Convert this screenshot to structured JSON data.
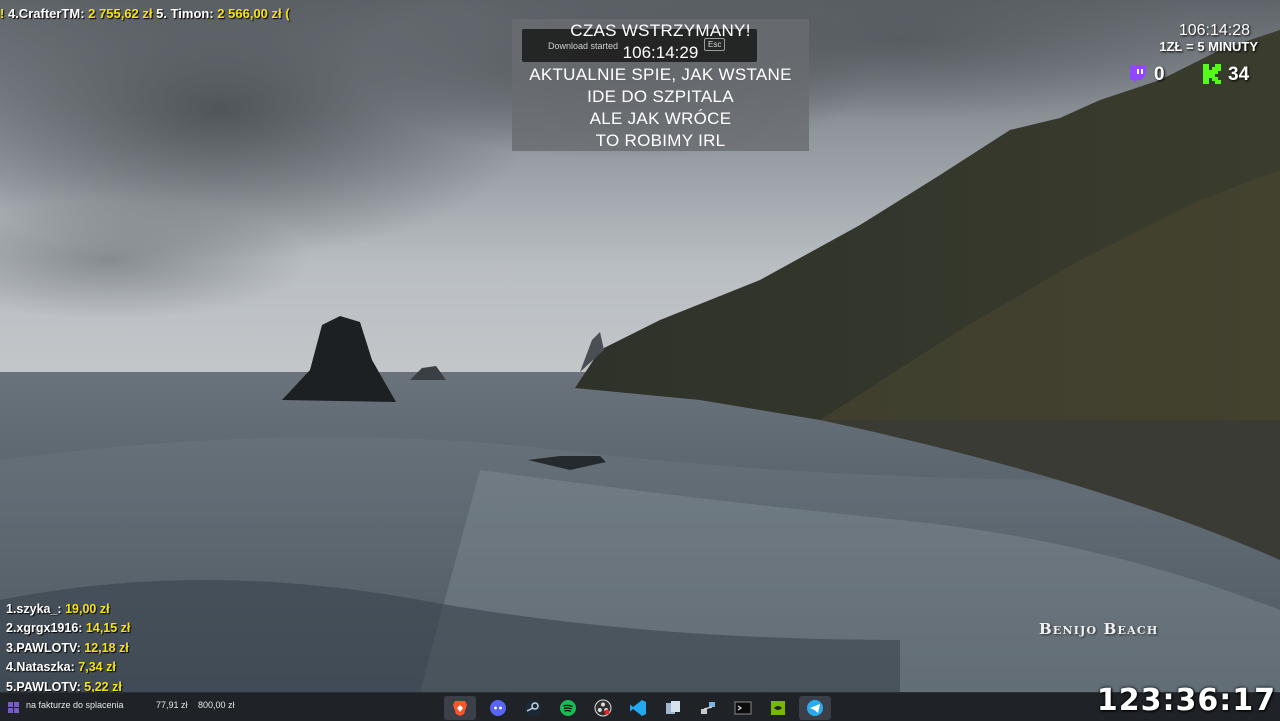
{
  "ticker": {
    "marker": "!",
    "entries": [
      {
        "label": "4.CrafterTM:",
        "amount": "2 755,62 zł"
      },
      {
        "label": "5. Timon:",
        "amount": "2 566,00 zł"
      }
    ],
    "trailing": "("
  },
  "pause": {
    "title": "CZAS WSTRZYMANY!",
    "timer": "106:14:29",
    "lines": [
      "AKTUALNIE SPIE, JAK WSTANE",
      "IDE DO SZPITALA",
      "ALE JAK WRÓCE",
      "TO ROBIMY IRL"
    ],
    "toast": {
      "text": "Download started",
      "key": "Esc"
    }
  },
  "top_right": {
    "timer": "106:14:28",
    "rate": "1ZŁ = 5 MINUTY",
    "twitch_count": "0",
    "kick_count": "34"
  },
  "donations": [
    {
      "label": "1.szyka_:",
      "amount": "19,00 zł"
    },
    {
      "label": "2.xgrgx1916:",
      "amount": "14,15 zł"
    },
    {
      "label": "3.PAWLOTV:",
      "amount": "12,18 zł"
    },
    {
      "label": "4.Nataszka:",
      "amount": "7,34 zł"
    },
    {
      "label": "5.PAWLOTV:",
      "amount": "5,22 zł"
    }
  ],
  "location": "Benijo Beach",
  "taskbar": {
    "bill_label": "na fakturze do splacenia",
    "bill_paid": "77,91 zł",
    "bill_total": "800,00 zł",
    "apps": [
      "brave-icon",
      "discord-icon",
      "steam-icon",
      "spotify-icon",
      "obs-icon",
      "vscode-icon",
      "files-icon",
      "network-icon",
      "terminal-icon",
      "nvidia-icon",
      "telegram-icon"
    ]
  },
  "uptime": "123:36:17",
  "colors": {
    "accent_yellow": "#f5e21b",
    "twitch": "#9146ff",
    "kick": "#53fc18"
  }
}
